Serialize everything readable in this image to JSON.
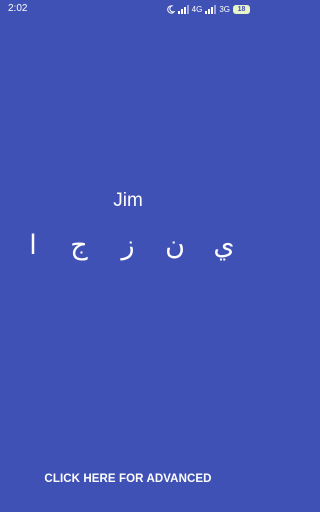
{
  "status_bar": {
    "time": "2:02",
    "network_1": "4G",
    "network_2": "3G",
    "battery": "18"
  },
  "word": "Jim",
  "letters": [
    "ا",
    "ج",
    "ز",
    "ن",
    "ي"
  ],
  "advanced_button_label": "CLICK HERE FOR ADVANCED",
  "colors": {
    "background": "#3f51b5",
    "text": "#ffffff",
    "battery": "#e8f5c8"
  }
}
